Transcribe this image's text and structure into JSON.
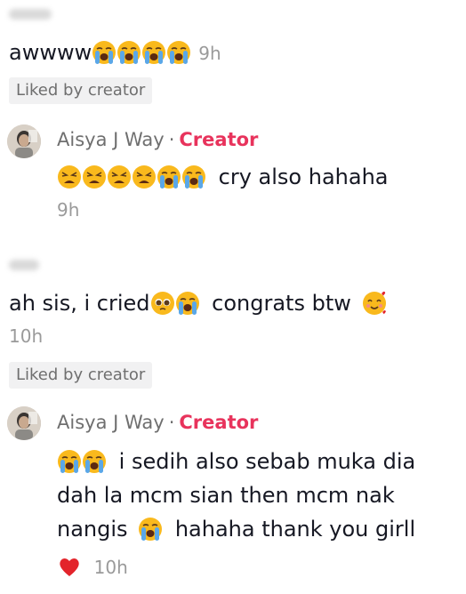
{
  "comments": [
    {
      "text": "awwww",
      "emoji_after": [
        "loudly-crying-face",
        "loudly-crying-face",
        "loudly-crying-face",
        "loudly-crying-face"
      ],
      "time": "9h",
      "liked_label": "Liked by creator",
      "reply": {
        "author": "Aisya J Way",
        "separator": "·",
        "badge": "Creator",
        "emoji_before": [
          "weary-face",
          "weary-face",
          "weary-face",
          "weary-face",
          "loudly-crying-face",
          "loudly-crying-face"
        ],
        "text": "cry also hahaha",
        "time": "9h"
      }
    },
    {
      "text_part1": "ah sis, i cried",
      "emoji_mid": [
        "pleading-face",
        "loudly-crying-face"
      ],
      "text_part2": "congrats btw",
      "emoji_end": [
        "smiling-face-with-hearts"
      ],
      "time": "10h",
      "liked_label": "Liked by creator",
      "reply": {
        "author": "Aisya J Way",
        "separator": "·",
        "badge": "Creator",
        "line1_text": "i sedih also sebab muka dia",
        "line2_text": "dah la mcm sian then mcm nak",
        "line3_part1": "nangis",
        "line3_part2": "hahaha thank you girll",
        "time": "10h"
      }
    }
  ],
  "colors": {
    "creator": "#e8335c",
    "muted": "#9a9a9a",
    "badge_bg": "#f1f1f2",
    "heart": "#e3242b",
    "emoji_yellow": "#f9b91d",
    "tear_blue": "#5aa7e8"
  }
}
